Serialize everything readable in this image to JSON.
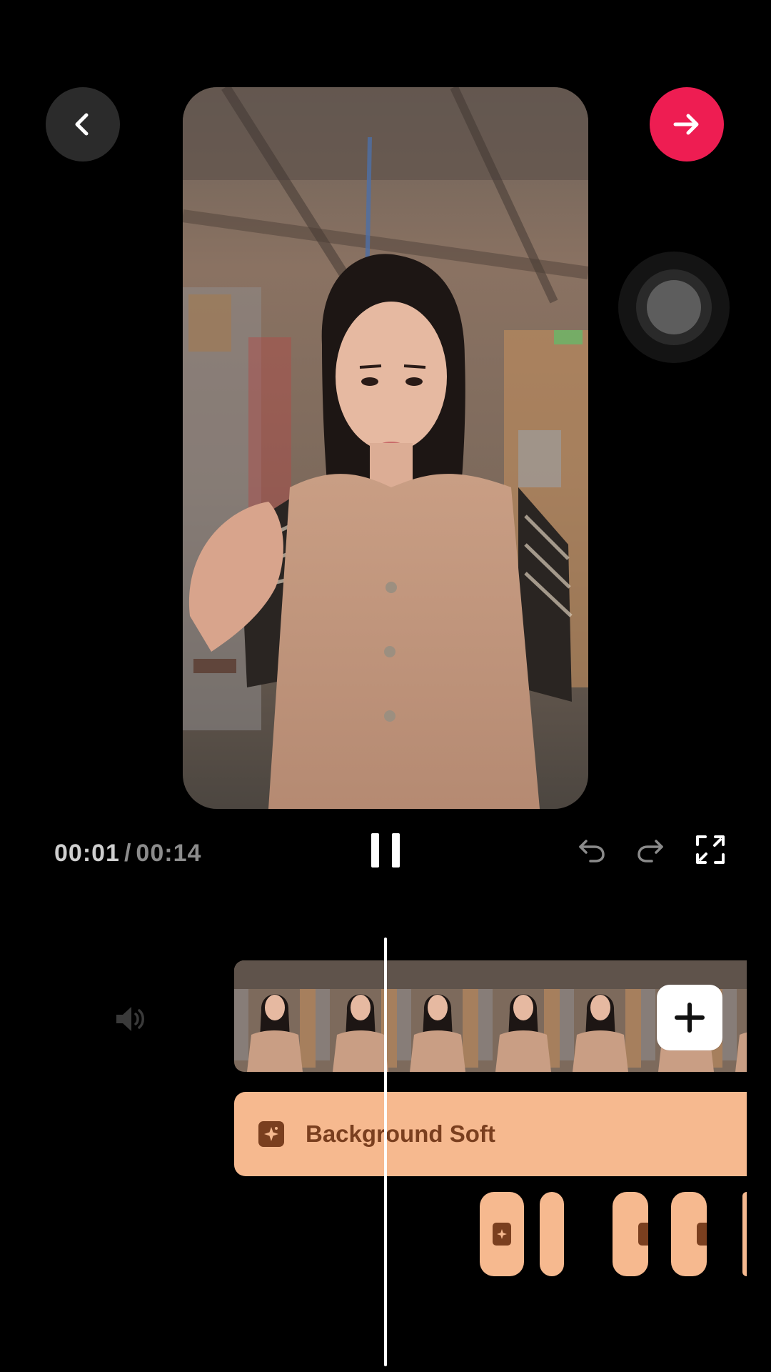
{
  "playback": {
    "current_time": "00:01",
    "separator": "/",
    "total_time": "00:14"
  },
  "timeline": {
    "effect_track_label": "Background Soft",
    "thumbnail_count": 7
  },
  "colors": {
    "next_button": "#ee1d52",
    "effect_track_fill": "#f6b98f",
    "effect_track_text": "#7a3f1f"
  },
  "icons": {
    "back": "chevron-left-icon",
    "next": "arrow-right-icon",
    "pause": "pause-icon",
    "undo": "undo-icon",
    "redo": "redo-icon",
    "fullscreen": "fullscreen-icon",
    "volume": "speaker-icon",
    "add_clip": "plus-icon",
    "effect": "sparkle-icon"
  }
}
